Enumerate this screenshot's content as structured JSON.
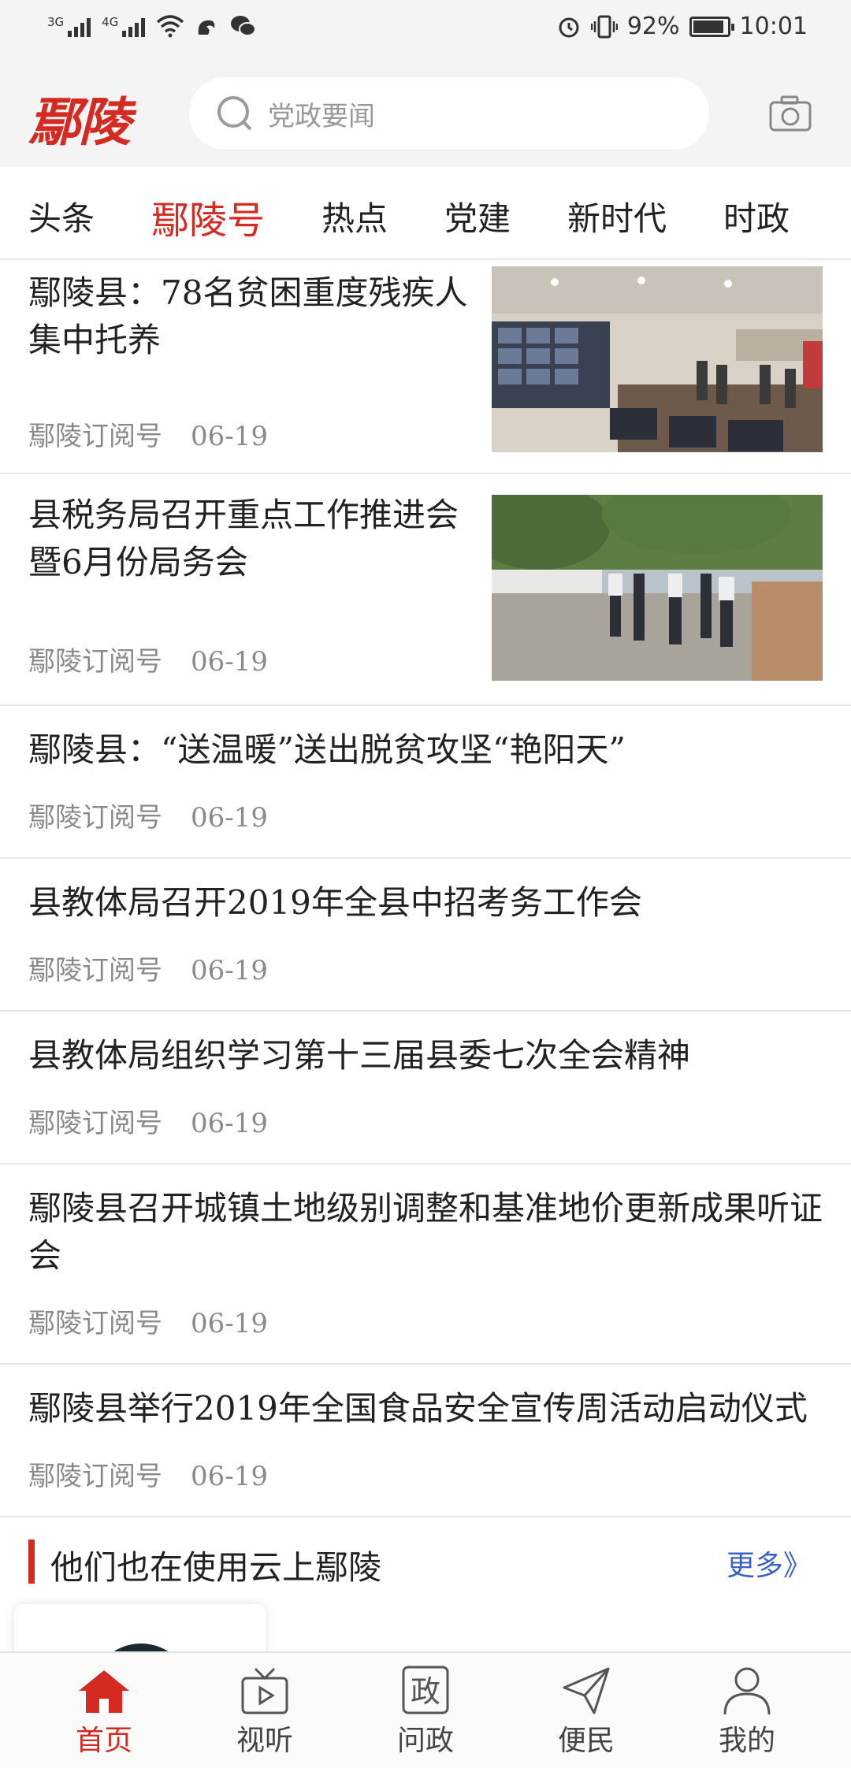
{
  "status_bar": {
    "network_1": "3G",
    "network_2": "4G",
    "battery": "92%",
    "battery_level": 0.92,
    "time": "10:01"
  },
  "header": {
    "logo": "鄢陵",
    "search_placeholder": "党政要闻"
  },
  "tabs": [
    {
      "label": "头条",
      "active": false
    },
    {
      "label": "鄢陵号",
      "active": true
    },
    {
      "label": "热点",
      "active": false
    },
    {
      "label": "党建",
      "active": false
    },
    {
      "label": "新时代",
      "active": false
    },
    {
      "label": "时政",
      "active": false
    }
  ],
  "news": [
    {
      "title": "鄢陵县：78名贫困重度残疾人集中托养",
      "source": "鄢陵订阅号",
      "date": "06-19",
      "has_image": true
    },
    {
      "title": "县税务局召开重点工作推进会暨6月份局务会",
      "source": "鄢陵订阅号",
      "date": "06-19",
      "has_image": true
    },
    {
      "title": "鄢陵县：“送温暖”送出脱贫攻坚“艳阳天”",
      "source": "鄢陵订阅号",
      "date": "06-19",
      "has_image": false
    },
    {
      "title": "县教体局召开2019年全县中招考务工作会",
      "source": "鄢陵订阅号",
      "date": "06-19",
      "has_image": false
    },
    {
      "title": "县教体局组织学习第十三届县委七次全会精神",
      "source": "鄢陵订阅号",
      "date": "06-19",
      "has_image": false
    },
    {
      "title": "鄢陵县召开城镇土地级别调整和基准地价更新成果听证会",
      "source": "鄢陵订阅号",
      "date": "06-19",
      "has_image": false
    },
    {
      "title": "鄢陵县举行2019年全国食品安全宣传周活动启动仪式",
      "source": "鄢陵订阅号",
      "date": "06-19",
      "has_image": false
    }
  ],
  "section": {
    "title": "他们也在使用云上鄢陵",
    "more": "更多》"
  },
  "bottom_nav": [
    {
      "label": "首页",
      "icon": "home-icon",
      "active": true
    },
    {
      "label": "视听",
      "icon": "tv-icon",
      "active": false
    },
    {
      "label": "问政",
      "icon": "zheng-icon",
      "active": false,
      "glyph": "政"
    },
    {
      "label": "便民",
      "icon": "paper-plane-icon",
      "active": false
    },
    {
      "label": "我的",
      "icon": "user-icon",
      "active": false
    }
  ],
  "colors": {
    "accent": "#d42a22",
    "link": "#3a62c9",
    "meta": "#8a8a8a"
  }
}
